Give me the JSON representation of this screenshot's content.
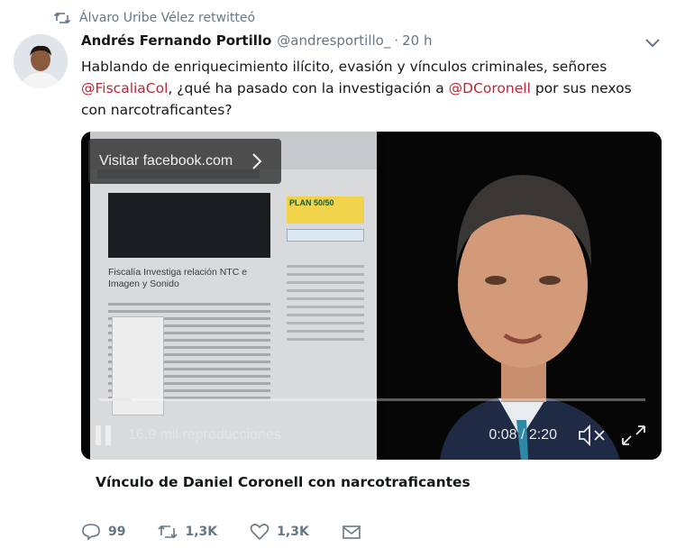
{
  "retweet": {
    "text": "Álvaro Uribe Vélez retwitteó",
    "icon": "retweet-icon"
  },
  "tweet": {
    "author_name": "Andrés Fernando Portillo",
    "author_handle": "@andresportillo_",
    "separator": "·",
    "time": "20 h",
    "text_1": "Hablando de enriquecimiento ilícito, evasión y vínculos criminales, señores ",
    "mention_1": "@FiscaliaCol",
    "text_2": ", ¿qué ha pasado con la investigación a ",
    "mention_2": "@DCoronell",
    "text_3": " por sus nexos con narcotraficantes?",
    "mention_color": "#c02434"
  },
  "media": {
    "visit_button": "Visitar facebook.com",
    "page_headline": "Fiscalía Investiga relación NTC e Imagen y Sonido",
    "plan_label": "PLAN 50/50",
    "views": "16,9 mil reproducciones",
    "time_readout": "0:08 / 2:20",
    "progress_fraction": 0.06
  },
  "card": {
    "title": "Vínculo de Daniel Coronell con narcotraficantes"
  },
  "actions": {
    "replies": "99",
    "retweets": "1,3K",
    "likes": "1,3K"
  }
}
